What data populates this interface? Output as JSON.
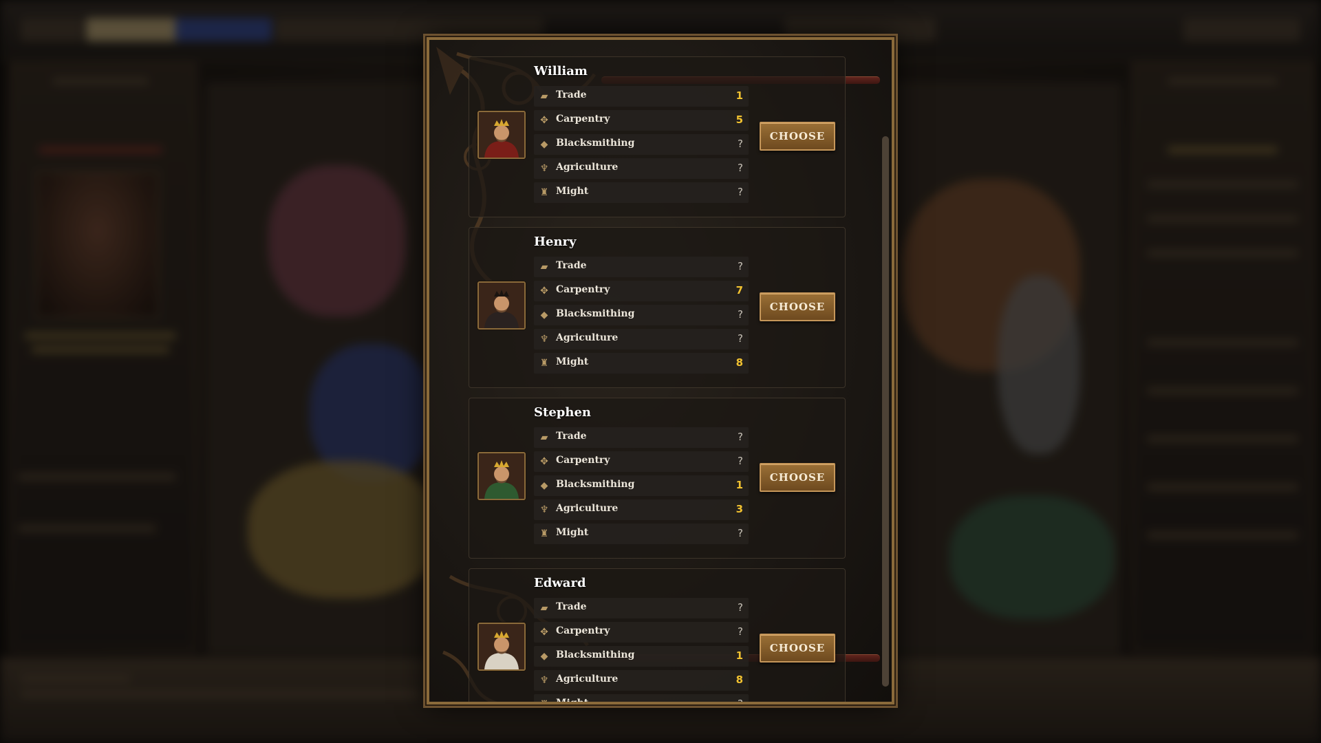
{
  "dialog": {
    "rulers": [
      {
        "name": "William",
        "portrait_icon": "king-portrait",
        "skills": [
          {
            "label": "Trade",
            "icon": "trade-icon",
            "value": "1"
          },
          {
            "label": "Carpentry",
            "icon": "carpentry-icon",
            "value": "5"
          },
          {
            "label": "Blacksmithing",
            "icon": "blacksmithing-icon",
            "value": "?"
          },
          {
            "label": "Agriculture",
            "icon": "agriculture-icon",
            "value": "?"
          },
          {
            "label": "Might",
            "icon": "might-icon",
            "value": "?"
          }
        ],
        "choose_label": "CHOOSE"
      },
      {
        "name": "Henry",
        "portrait_icon": "king-portrait",
        "skills": [
          {
            "label": "Trade",
            "icon": "trade-icon",
            "value": "?"
          },
          {
            "label": "Carpentry",
            "icon": "carpentry-icon",
            "value": "7"
          },
          {
            "label": "Blacksmithing",
            "icon": "blacksmithing-icon",
            "value": "?"
          },
          {
            "label": "Agriculture",
            "icon": "agriculture-icon",
            "value": "?"
          },
          {
            "label": "Might",
            "icon": "might-icon",
            "value": "8"
          }
        ],
        "choose_label": "CHOOSE"
      },
      {
        "name": "Stephen",
        "portrait_icon": "king-portrait",
        "skills": [
          {
            "label": "Trade",
            "icon": "trade-icon",
            "value": "?"
          },
          {
            "label": "Carpentry",
            "icon": "carpentry-icon",
            "value": "?"
          },
          {
            "label": "Blacksmithing",
            "icon": "blacksmithing-icon",
            "value": "1"
          },
          {
            "label": "Agriculture",
            "icon": "agriculture-icon",
            "value": "3"
          },
          {
            "label": "Might",
            "icon": "might-icon",
            "value": "?"
          }
        ],
        "choose_label": "CHOOSE"
      },
      {
        "name": "Edward",
        "portrait_icon": "king-portrait",
        "skills": [
          {
            "label": "Trade",
            "icon": "trade-icon",
            "value": "?"
          },
          {
            "label": "Carpentry",
            "icon": "carpentry-icon",
            "value": "?"
          },
          {
            "label": "Blacksmithing",
            "icon": "blacksmithing-icon",
            "value": "1"
          },
          {
            "label": "Agriculture",
            "icon": "agriculture-icon",
            "value": "8"
          },
          {
            "label": "Might",
            "icon": "might-icon",
            "value": "?"
          }
        ],
        "choose_label": "CHOOSE"
      }
    ]
  },
  "colors": {
    "accent_gold": "#f2c230",
    "button_bronze": "#8a6230",
    "frame_gold": "#8a6a3a"
  }
}
